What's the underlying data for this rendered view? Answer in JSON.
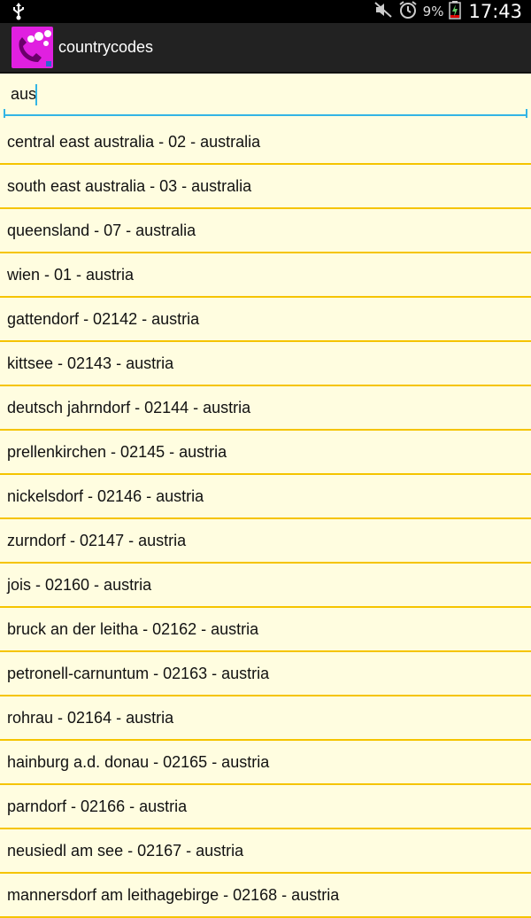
{
  "status_bar": {
    "icons": [
      "usb-icon",
      "mute-icon",
      "alarm-icon",
      "battery-charging-icon"
    ],
    "battery_percent": "9%",
    "time": "17:43"
  },
  "action_bar": {
    "app_title": "countrycodes"
  },
  "search": {
    "value": "aus",
    "accent_color": "#33b5e5"
  },
  "colors": {
    "background": "#fffde0",
    "divider": "#f5c400",
    "app_icon": "#e020e0"
  },
  "results": [
    "central east australia - 02 - australia",
    "south east australia - 03 - australia",
    "queensland - 07 - australia",
    "wien - 01 - austria",
    "gattendorf - 02142 - austria",
    "kittsee - 02143 - austria",
    "deutsch jahrndorf - 02144 - austria",
    "prellenkirchen - 02145 - austria",
    "nickelsdorf - 02146 - austria",
    "zurndorf - 02147 - austria",
    "jois - 02160 - austria",
    "bruck an der leitha - 02162 - austria",
    "petronell-carnuntum - 02163 - austria",
    "rohrau - 02164 - austria",
    "hainburg a.d. donau - 02165 - austria",
    "parndorf - 02166 - austria",
    "neusiedl am see - 02167 - austria",
    "mannersdorf am leithagebirge - 02168 - austria"
  ]
}
